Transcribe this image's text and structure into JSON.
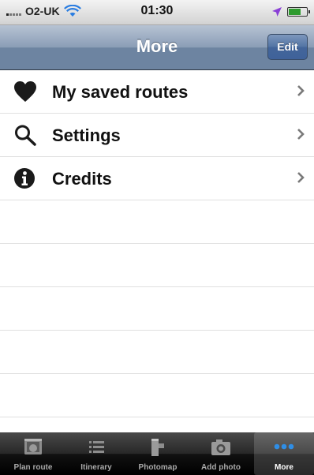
{
  "status_bar": {
    "carrier": "O2-UK",
    "time": "01:30"
  },
  "nav": {
    "title": "More",
    "edit_label": "Edit"
  },
  "menu": [
    {
      "label": "My saved routes",
      "icon": "heart-icon"
    },
    {
      "label": "Settings",
      "icon": "magnifier-icon"
    },
    {
      "label": "Credits",
      "icon": "info-icon"
    }
  ],
  "tabs": [
    {
      "label": "Plan route",
      "icon": "plan-route-icon"
    },
    {
      "label": "Itinerary",
      "icon": "list-icon"
    },
    {
      "label": "Photomap",
      "icon": "photomap-icon"
    },
    {
      "label": "Add photo",
      "icon": "camera-icon"
    },
    {
      "label": "More",
      "icon": "more-dots-icon",
      "active": true
    }
  ],
  "colors": {
    "nav_blue": "#6d84a1",
    "battery_green": "#2f9b2f",
    "active_dots": "#2f8ee6"
  }
}
